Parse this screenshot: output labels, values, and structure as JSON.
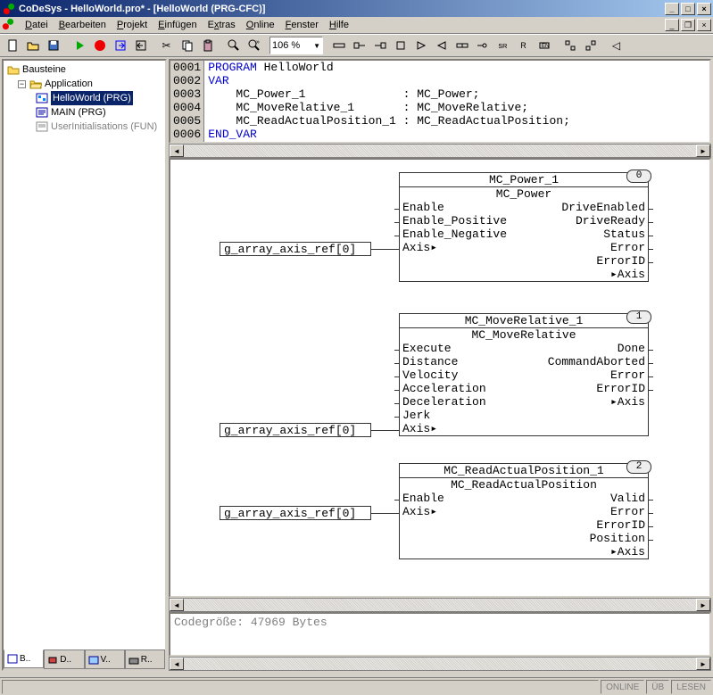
{
  "title": "CoDeSys - HelloWorld.pro* - [HelloWorld (PRG-CFC)]",
  "menu": {
    "datei": "Datei",
    "bearbeiten": "Bearbeiten",
    "projekt": "Projekt",
    "einfuegen": "Einfügen",
    "extras": "Extras",
    "online": "Online",
    "fenster": "Fenster",
    "hilfe": "Hilfe"
  },
  "toolbar": {
    "zoom": "106 %"
  },
  "tree": {
    "root": "Bausteine",
    "app": "Application",
    "items": [
      {
        "label": "HelloWorld (PRG)",
        "selected": true
      },
      {
        "label": "MAIN (PRG)",
        "selected": false
      },
      {
        "label": "UserInitialisations (FUN)",
        "disabled": true
      }
    ],
    "tabs": [
      "B..",
      "D..",
      "V..",
      "R.."
    ]
  },
  "code": {
    "lines": [
      {
        "n": "0001",
        "kw": "PROGRAM",
        "rest": " HelloWorld"
      },
      {
        "n": "0002",
        "kw": "VAR",
        "rest": ""
      },
      {
        "n": "0003",
        "kw": "",
        "rest": "    MC_Power_1              : MC_Power;"
      },
      {
        "n": "0004",
        "kw": "",
        "rest": "    MC_MoveRelative_1       : MC_MoveRelative;"
      },
      {
        "n": "0005",
        "kw": "",
        "rest": "    MC_ReadActualPosition_1 : MC_ReadActualPosition;"
      },
      {
        "n": "0006",
        "kw": "END_VAR",
        "rest": ""
      }
    ]
  },
  "blocks": {
    "b0": {
      "instance": "MC_Power_1",
      "type": "MC_Power",
      "badge": "0",
      "inputs": [
        "Enable",
        "Enable_Positive",
        "Enable_Negative",
        "Axis▸"
      ],
      "outputs": [
        "DriveEnabled",
        "DriveReady",
        "Status",
        "Error",
        "ErrorID",
        "▸Axis"
      ],
      "input_var": "g_array_axis_ref[0]"
    },
    "b1": {
      "instance": "MC_MoveRelative_1",
      "type": "MC_MoveRelative",
      "badge": "1",
      "inputs": [
        "Execute",
        "Distance",
        "Velocity",
        "Acceleration",
        "Deceleration",
        "Jerk",
        "Axis▸"
      ],
      "outputs": [
        "Done",
        "CommandAborted",
        "Error",
        "ErrorID",
        "▸Axis"
      ],
      "input_var": "g_array_axis_ref[0]"
    },
    "b2": {
      "instance": "MC_ReadActualPosition_1",
      "type": "MC_ReadActualPosition",
      "badge": "2",
      "inputs": [
        "Enable",
        "Axis▸"
      ],
      "outputs": [
        "Valid",
        "Error",
        "ErrorID",
        "Position",
        "▸Axis"
      ],
      "input_var": "g_array_axis_ref[0]"
    }
  },
  "messages": {
    "line1": "Codegröße: 47969 Bytes"
  },
  "status": {
    "online": "ONLINE",
    "ub": "ÜB",
    "lesen": "LESEN"
  }
}
